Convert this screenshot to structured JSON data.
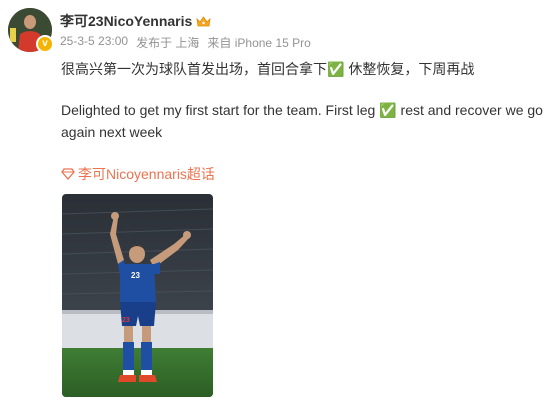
{
  "post": {
    "author": "李可23NicoYennaris",
    "date": "25-3-5 23:00",
    "posted_from": "发布于 上海",
    "device": "来自 iPhone 15 Pro",
    "text_zh": "很高兴第一次为球队首发出场，首回合拿下✅ 休整恢复，下周再战",
    "text_en": "Delighted to get my first start for the team. First leg ✅ rest and recover we go again next week",
    "topic": "李可Nicoyennaris超话"
  },
  "photo": {
    "jersey_number": "23"
  },
  "colors": {
    "topic": "#eb7350",
    "meta": "#939393",
    "text": "#333333",
    "badge": "#f5b400"
  }
}
